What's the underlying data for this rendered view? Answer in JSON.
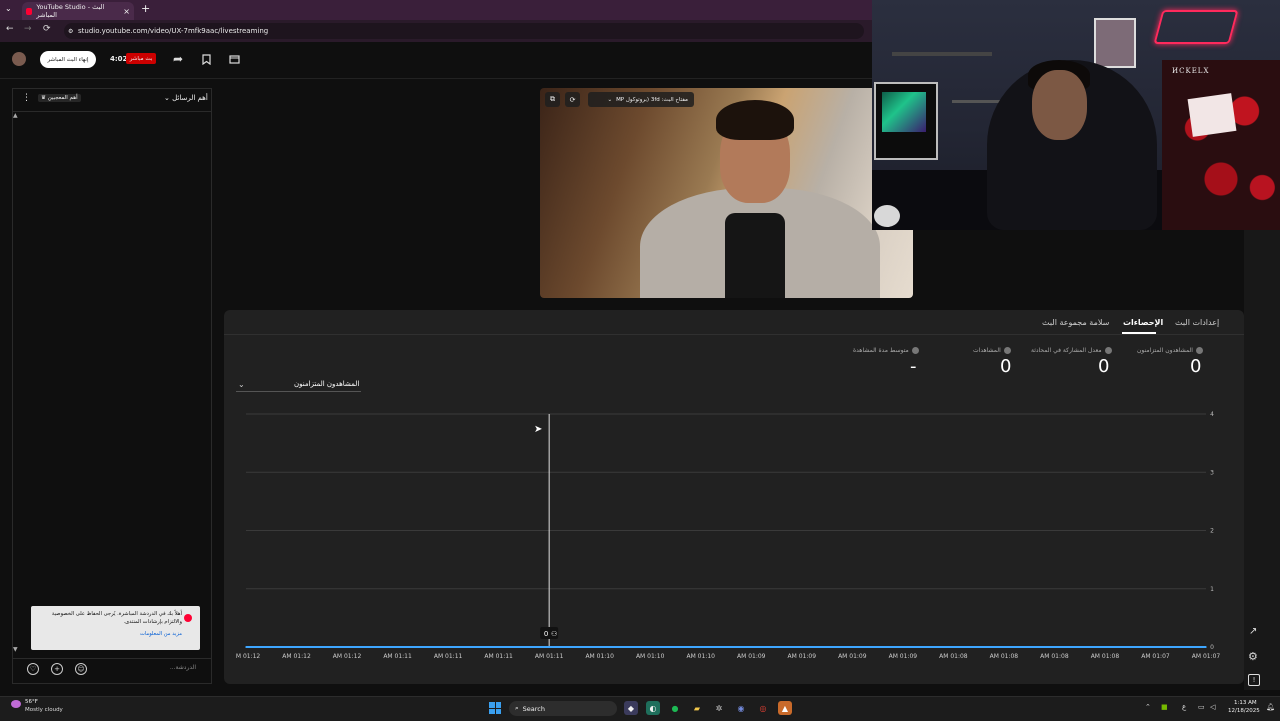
{
  "browser": {
    "tab_title": "YouTube Studio - البث المباشر",
    "tab_close": "×",
    "new_tab": "+",
    "url": "studio.youtube.com/video/UX-7mfk9aac/livestreaming",
    "nav_back": "←",
    "nav_forward": "→",
    "nav_reload": "⟳"
  },
  "header": {
    "end_stream_label": "إنهاء البث المباشر",
    "timer": "4:02",
    "live_badge": "بث مباشر"
  },
  "chat": {
    "title": "أهم الرسائل",
    "favorites_chip": "أهم المعجبين",
    "notice_text": "أهلاً بك في الدردشة المباشرة. يُرجى الحفاظ على الخصوصية والالتزام بإرشادات المنتدى.",
    "notice_link": "مزيد من المعلومات",
    "input_placeholder": "الدردشة..."
  },
  "preview": {
    "stream_key_label": "مفتاح البث: 3fd (بروتوكول MP"
  },
  "webcam": {
    "sign_text": "ИCKELX"
  },
  "tabs": [
    {
      "label": "إعدادات البث"
    },
    {
      "label": "الإحصاءات"
    },
    {
      "label": "سلامة مجموعة البث"
    }
  ],
  "metrics": [
    {
      "label": "المشاهدون المتزامنون",
      "value": "0"
    },
    {
      "label": "معدل المشاركة في المحادثة",
      "value": "0"
    },
    {
      "label": "المشاهدات",
      "value": "0"
    },
    {
      "label": "متوسط مدة المشاهدة",
      "value": "-"
    }
  ],
  "metric_selector": "المشاهدون المتزامنون",
  "chart_data": {
    "type": "line",
    "title": "",
    "xlabel": "",
    "ylabel": "",
    "x": [
      "AM 01:12",
      "AM 01:12",
      "AM 01:12",
      "AM 01:11",
      "AM 01:11",
      "AM 01:11",
      "AM 01:11",
      "AM 01:10",
      "AM 01:10",
      "AM 01:10",
      "AM 01:09",
      "AM 01:09",
      "AM 01:09",
      "AM 01:09",
      "AM 01:08",
      "AM 01:08",
      "AM 01:08",
      "AM 01:08",
      "AM 01:07",
      "AM 01:07"
    ],
    "series": [
      {
        "values": [
          0,
          0,
          0,
          0,
          0,
          0,
          0,
          0,
          0,
          0,
          0,
          0,
          0,
          0,
          0,
          0,
          0,
          0,
          0,
          0
        ]
      }
    ],
    "yticks": [
      "0",
      "1",
      "2",
      "3",
      "4"
    ],
    "ylim": [
      0,
      4
    ],
    "grid": true,
    "hover_index": 6,
    "hover_label": "0",
    "line_color": "#3ea6ff"
  },
  "taskbar": {
    "weather_temp": "56°F",
    "weather_desc": "Mostly cloudy",
    "search_label": "Search",
    "time": "1:13 AM",
    "date": "12/18/2025",
    "lang": "ع"
  }
}
